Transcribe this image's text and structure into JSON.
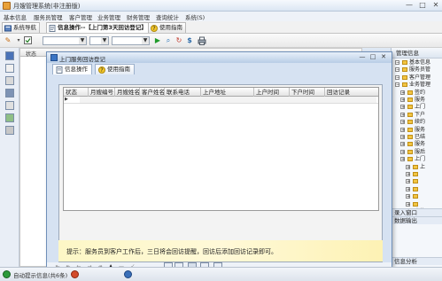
{
  "window": {
    "title": "月嫂管理系统(非注册版)",
    "controls": [
      "—",
      "□",
      "✕"
    ]
  },
  "menu": [
    "基本信息",
    "服务员管理",
    "客户管理",
    "业务管理",
    "财务管理",
    "查询统计",
    "系统(S)"
  ],
  "tabs": [
    {
      "label": "系统导航",
      "icon": "navigation-icon"
    },
    {
      "label": "信息操作--【上门第3天回访登记】",
      "icon": "info-doc-icon",
      "active": true
    },
    {
      "label": "使用指南",
      "icon": "help-icon"
    }
  ],
  "toolbar": {
    "combo1": "",
    "combo2": "",
    "combo3": ""
  },
  "bg_list": {
    "columns": [
      "状态"
    ]
  },
  "dialog": {
    "title": "上门服务回访登记",
    "tabs": [
      {
        "label": "信息操作",
        "icon": "info-doc-icon",
        "active": true
      },
      {
        "label": "使用指南",
        "icon": "help-icon"
      }
    ],
    "grid": {
      "columns": [
        "状态",
        "月嫂编号",
        "月嫂姓名",
        "客户姓名",
        "联系电话",
        "上户地址",
        "上户时间",
        "下户时间",
        "回访记录"
      ],
      "rows": [
        {
          "indicator": "▶"
        }
      ]
    },
    "hint": "提示：服务员到客户工作后，三日将会回访提醒，回访后添加回访记录即可。"
  },
  "right_panel": {
    "title": "管理信息",
    "tree": [
      {
        "label": "基本信息",
        "level": 0,
        "kind": "expander"
      },
      {
        "label": "服务员管",
        "level": 0,
        "kind": "expander"
      },
      {
        "label": "客户管理",
        "level": 0,
        "kind": "expander"
      },
      {
        "label": "业务管理",
        "level": 0,
        "kind": "expander"
      },
      {
        "label": "签约",
        "level": 1,
        "kind": "item"
      },
      {
        "label": "服务",
        "level": 1,
        "kind": "item"
      },
      {
        "label": "上门",
        "level": 1,
        "kind": "item"
      },
      {
        "label": "下户",
        "level": 1,
        "kind": "item"
      },
      {
        "label": "续约",
        "level": 1,
        "kind": "item"
      },
      {
        "label": "服务",
        "level": 1,
        "kind": "item"
      },
      {
        "label": "已结",
        "level": 1,
        "kind": "item"
      },
      {
        "label": "服务",
        "level": 1,
        "kind": "item"
      },
      {
        "label": "服后",
        "level": 1,
        "kind": "item"
      },
      {
        "label": "上门",
        "level": 1,
        "kind": "item"
      },
      {
        "label": "上",
        "level": 2,
        "kind": "item"
      },
      {
        "label": "",
        "level": 2,
        "kind": "item"
      },
      {
        "label": "",
        "level": 2,
        "kind": "item"
      },
      {
        "label": "",
        "level": 2,
        "kind": "item"
      },
      {
        "label": "",
        "level": 2,
        "kind": "item"
      },
      {
        "label": "",
        "level": 2,
        "kind": "item"
      },
      {
        "label": "事签",
        "level": 1,
        "kind": "item"
      }
    ],
    "bottom1": "录入窗口",
    "bottom2": "数据输出",
    "bottom3": "信息分析"
  },
  "statusbar": {
    "item1": "自动提示信息(共6条)"
  }
}
